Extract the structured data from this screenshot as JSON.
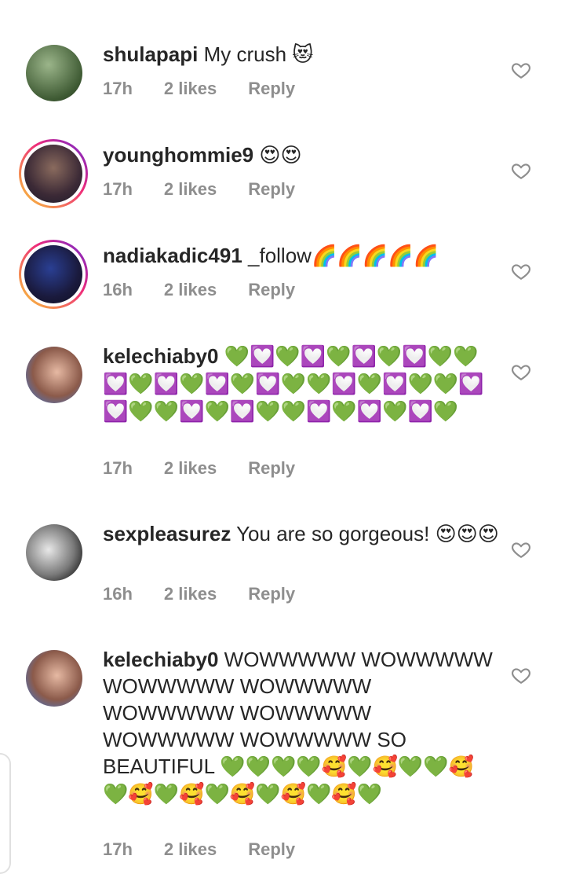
{
  "comments": [
    {
      "username": "shulapapi",
      "text": "My crush",
      "emoji": "😻",
      "time": "17h",
      "likes": "2 likes",
      "reply": "Reply"
    },
    {
      "username": "younghommie9",
      "text": "",
      "emoji": "😍😍",
      "time": "17h",
      "likes": "2 likes",
      "reply": "Reply"
    },
    {
      "username": "nadiakadic491",
      "text": "_follow",
      "emoji": "🌈🌈🌈🌈🌈",
      "time": "16h",
      "likes": "2 likes",
      "reply": "Reply"
    },
    {
      "username": "kelechiaby0",
      "text": "",
      "emoji": "💚💟💚💟💚💟💚💟💚💚💟💚💟💚💟💚💟💚💚💟💚💟💚💚💟💟💚💚💟💚💟💚💚💟💚💟💚💟💚",
      "time": "17h",
      "likes": "2 likes",
      "reply": "Reply"
    },
    {
      "username": "sexpleasurez",
      "text": "You are so gorgeous!",
      "emoji": "😍😍😍",
      "time": "16h",
      "likes": "2 likes",
      "reply": "Reply"
    },
    {
      "username": "kelechiaby0",
      "text": "WOWWWWW WOWWWWW WOWWWWW WOWWWWW WOWWWWW WOWWWWW WOWWWWW WOWWWWW SO BEAUTIFUL",
      "emoji": "💚💚💚💚🥰💚🥰💚💚🥰💚🥰💚🥰💚🥰💚🥰💚🥰💚",
      "time": "17h",
      "likes": "2 likes",
      "reply": "Reply"
    }
  ],
  "colors": {
    "text": "#262626",
    "meta": "#8e8e8e",
    "story_ring_start": "#f9ce34",
    "story_ring_end": "#ee2a7b"
  },
  "icons": {
    "like": "heart-outline-icon"
  }
}
